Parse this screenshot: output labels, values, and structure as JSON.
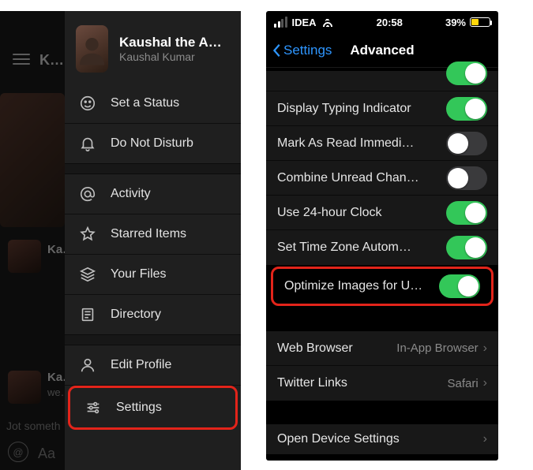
{
  "left_peek": {
    "title_fragment": "K…",
    "row1_name": "Ka…",
    "row2_name": "Ka…",
    "row2_sub": "we…",
    "jot_placeholder": "Jot someth",
    "aa_label": "Aa"
  },
  "drawer": {
    "title": "Kaushal the An…",
    "subtitle": "Kaushal Kumar",
    "items": {
      "status": "Set a Status",
      "dnd": "Do Not Disturb",
      "activity": "Activity",
      "starred": "Starred Items",
      "files": "Your Files",
      "directory": "Directory",
      "edit_profile": "Edit Profile",
      "settings": "Settings"
    }
  },
  "status": {
    "carrier": "IDEA",
    "time": "20:58",
    "battery_pct": "39%"
  },
  "nav": {
    "back": "Settings",
    "title": "Advanced"
  },
  "settings": {
    "rows": [
      {
        "label": "Display Typing Indicator",
        "on": true
      },
      {
        "label": "Mark As Read Immedi…",
        "on": false
      },
      {
        "label": "Combine Unread Chan…",
        "on": false
      },
      {
        "label": "Use 24-hour Clock",
        "on": true
      },
      {
        "label": "Set Time Zone Autom…",
        "on": true
      },
      {
        "label": "Optimize Images for U…",
        "on": true
      }
    ],
    "links": [
      {
        "label": "Web Browser",
        "value": "In-App Browser"
      },
      {
        "label": "Twitter Links",
        "value": "Safari"
      }
    ],
    "device": "Open Device Settings"
  }
}
